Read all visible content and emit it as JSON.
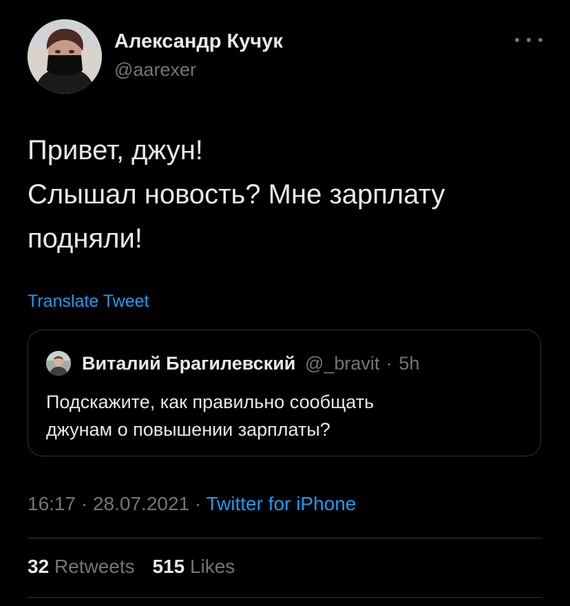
{
  "author": {
    "name": "Александр Кучук",
    "handle": "@aarexer"
  },
  "tweet_lines": [
    "Привет, джун!",
    "Слышал новость? Мне зарплату",
    "подняли!"
  ],
  "translate_label": "Translate Tweet",
  "quote": {
    "name": "Виталий Брагилевский",
    "handle": "@_bravit",
    "separator": "·",
    "time": "5h",
    "lines": [
      "Подскажите, как правильно сообщать",
      "джунам о повышении зарплаты?"
    ]
  },
  "meta": {
    "time": "16:17",
    "separator": "·",
    "date": "28.07.2021",
    "source": "Twitter for iPhone"
  },
  "stats": {
    "retweets_count": "32",
    "retweets_label": "Retweets",
    "likes_count": "515",
    "likes_label": "Likes"
  },
  "icons": {
    "more": "more-horizontal-icon"
  },
  "colors": {
    "background": "#000000",
    "text": "#e7e9ea",
    "secondary": "#71767b",
    "link": "#1d9bf0",
    "border": "#2f3336"
  }
}
